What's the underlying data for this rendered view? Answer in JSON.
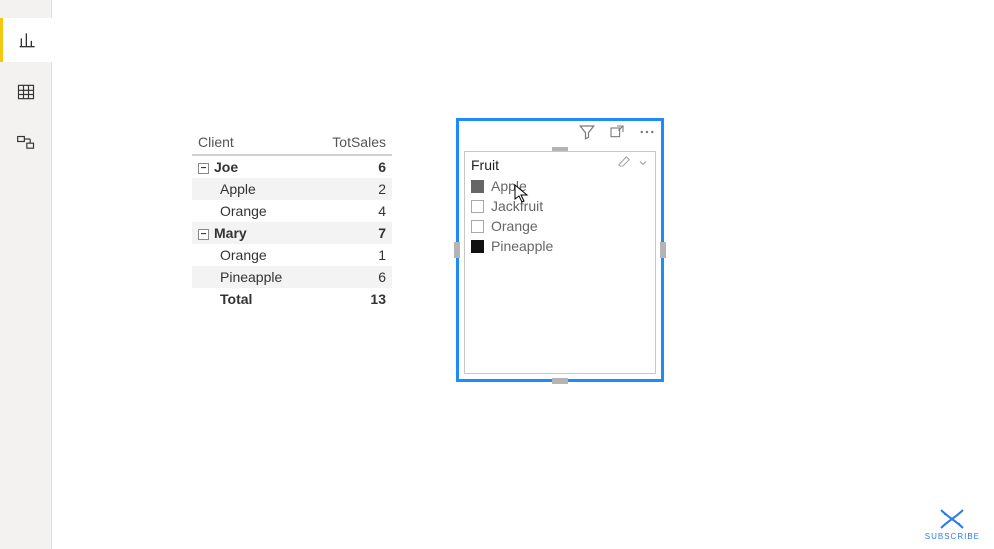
{
  "sidebar": {
    "views": [
      {
        "name": "report-view",
        "active": true
      },
      {
        "name": "data-view",
        "active": false
      },
      {
        "name": "model-view",
        "active": false
      }
    ]
  },
  "matrix": {
    "columns": [
      "Client",
      "TotSales"
    ],
    "groups": [
      {
        "label": "Joe",
        "subtotal": 6,
        "rows": [
          {
            "label": "Apple",
            "value": 2
          },
          {
            "label": "Orange",
            "value": 4
          }
        ]
      },
      {
        "label": "Mary",
        "subtotal": 7,
        "rows": [
          {
            "label": "Orange",
            "value": 1
          },
          {
            "label": "Pineapple",
            "value": 6
          }
        ]
      }
    ],
    "total_label": "Total",
    "total_value": 13,
    "expander_glyph": "−"
  },
  "slicer": {
    "title": "Fruit",
    "items": [
      {
        "label": "Apple",
        "state": "filled-grey"
      },
      {
        "label": "Jackfruit",
        "state": "empty"
      },
      {
        "label": "Orange",
        "state": "empty"
      },
      {
        "label": "Pineapple",
        "state": "filled-black"
      }
    ]
  },
  "watermark": {
    "label": "SUBSCRIBE"
  }
}
